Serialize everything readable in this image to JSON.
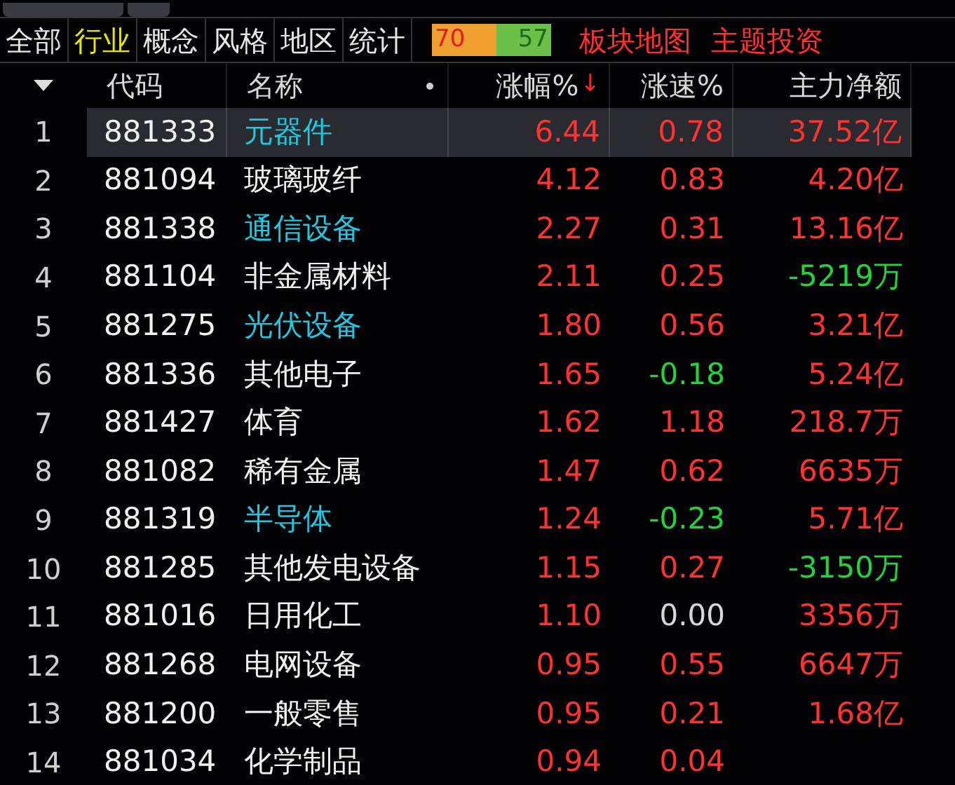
{
  "top_tabs": [
    {
      "label": "全部",
      "selected": false
    },
    {
      "label": "行业",
      "selected": true
    },
    {
      "label": "概念",
      "selected": false
    },
    {
      "label": "风格",
      "selected": false
    },
    {
      "label": "地区",
      "selected": false
    },
    {
      "label": "统计",
      "selected": false
    }
  ],
  "breadth": {
    "up": "70",
    "down": "57"
  },
  "links": [
    "板块地图",
    "主题投资"
  ],
  "table": {
    "columns": [
      "代码",
      "名称",
      "涨幅%",
      "涨速%",
      "主力净额"
    ],
    "sort_arrow": "↓",
    "rows": [
      {
        "index": "1",
        "code": "881333",
        "name": "元器件",
        "highlight": true,
        "selected": true,
        "change": {
          "text": "6.44",
          "color": "#ff3232"
        },
        "speed": {
          "text": "0.78",
          "color": "#ff3232"
        },
        "flow": {
          "text": "37.52亿",
          "color": "#ff3232"
        }
      },
      {
        "index": "2",
        "code": "881094",
        "name": "玻璃玻纤",
        "highlight": false,
        "selected": false,
        "change": {
          "text": "4.12",
          "color": "#ff3232"
        },
        "speed": {
          "text": "0.83",
          "color": "#ff3232"
        },
        "flow": {
          "text": "4.20亿",
          "color": "#ff3232"
        }
      },
      {
        "index": "3",
        "code": "881338",
        "name": "通信设备",
        "highlight": true,
        "selected": false,
        "change": {
          "text": "2.27",
          "color": "#ff3232"
        },
        "speed": {
          "text": "0.31",
          "color": "#ff3232"
        },
        "flow": {
          "text": "13.16亿",
          "color": "#ff3232"
        }
      },
      {
        "index": "4",
        "code": "881104",
        "name": "非金属材料",
        "highlight": false,
        "selected": false,
        "change": {
          "text": "2.11",
          "color": "#ff3232"
        },
        "speed": {
          "text": "0.25",
          "color": "#ff3232"
        },
        "flow": {
          "text": "-5219万",
          "color": "#22d33a"
        }
      },
      {
        "index": "5",
        "code": "881275",
        "name": "光伏设备",
        "highlight": true,
        "selected": false,
        "change": {
          "text": "1.80",
          "color": "#ff3232"
        },
        "speed": {
          "text": "0.56",
          "color": "#ff3232"
        },
        "flow": {
          "text": "3.21亿",
          "color": "#ff3232"
        }
      },
      {
        "index": "6",
        "code": "881336",
        "name": "其他电子",
        "highlight": false,
        "selected": false,
        "change": {
          "text": "1.65",
          "color": "#ff3232"
        },
        "speed": {
          "text": "-0.18",
          "color": "#22d33a"
        },
        "flow": {
          "text": "5.24亿",
          "color": "#ff3232"
        }
      },
      {
        "index": "7",
        "code": "881427",
        "name": "体育",
        "highlight": false,
        "selected": false,
        "change": {
          "text": "1.62",
          "color": "#ff3232"
        },
        "speed": {
          "text": "1.18",
          "color": "#ff3232"
        },
        "flow": {
          "text": "218.7万",
          "color": "#ff3232"
        }
      },
      {
        "index": "8",
        "code": "881082",
        "name": "稀有金属",
        "highlight": false,
        "selected": false,
        "change": {
          "text": "1.47",
          "color": "#ff3232"
        },
        "speed": {
          "text": "0.62",
          "color": "#ff3232"
        },
        "flow": {
          "text": "6635万",
          "color": "#ff3232"
        }
      },
      {
        "index": "9",
        "code": "881319",
        "name": "半导体",
        "highlight": true,
        "selected": false,
        "change": {
          "text": "1.24",
          "color": "#ff3232"
        },
        "speed": {
          "text": "-0.23",
          "color": "#22d33a"
        },
        "flow": {
          "text": "5.71亿",
          "color": "#ff3232"
        }
      },
      {
        "index": "10",
        "code": "881285",
        "name": "其他发电设备",
        "highlight": false,
        "selected": false,
        "change": {
          "text": "1.15",
          "color": "#ff3232"
        },
        "speed": {
          "text": "0.27",
          "color": "#ff3232"
        },
        "flow": {
          "text": "-3150万",
          "color": "#22d33a"
        }
      },
      {
        "index": "11",
        "code": "881016",
        "name": "日用化工",
        "highlight": false,
        "selected": false,
        "change": {
          "text": "1.10",
          "color": "#ff3232"
        },
        "speed": {
          "text": "0.00",
          "color": "#d8d8d8"
        },
        "flow": {
          "text": "3356万",
          "color": "#ff3232"
        }
      },
      {
        "index": "12",
        "code": "881268",
        "name": "电网设备",
        "highlight": false,
        "selected": false,
        "change": {
          "text": "0.95",
          "color": "#ff3232"
        },
        "speed": {
          "text": "0.55",
          "color": "#ff3232"
        },
        "flow": {
          "text": "6647万",
          "color": "#ff3232"
        }
      },
      {
        "index": "13",
        "code": "881200",
        "name": "一般零售",
        "highlight": false,
        "selected": false,
        "change": {
          "text": "0.95",
          "color": "#ff3232"
        },
        "speed": {
          "text": "0.21",
          "color": "#ff3232"
        },
        "flow": {
          "text": "1.68亿",
          "color": "#ff3232"
        }
      },
      {
        "index": "14",
        "code": "881034",
        "name": "化学制品",
        "highlight": false,
        "selected": false,
        "change": {
          "text": "0.94",
          "color": "#ff3232"
        },
        "speed": {
          "text": "0.04",
          "color": "#ff3232"
        }
      }
    ]
  }
}
